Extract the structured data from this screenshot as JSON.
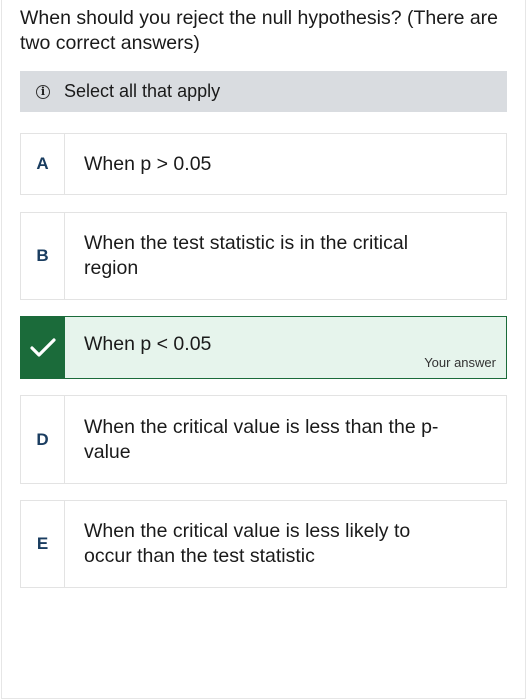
{
  "question": "When should you reject the null hypothesis? (There are two correct answers)",
  "hint": {
    "icon": "info-icon",
    "label": "Select all that apply"
  },
  "options": [
    {
      "letter": "A",
      "text": "When p > 0.05",
      "selected": false
    },
    {
      "letter": "B",
      "text": "When the test statistic is in the critical region",
      "selected": false
    },
    {
      "letter": "",
      "text": "When p < 0.05",
      "selected": true,
      "tag": "Your answer"
    },
    {
      "letter": "D",
      "text": "When the critical value is less than the p-value",
      "selected": false
    },
    {
      "letter": "E",
      "text": "When the critical value is less likely to occur than the test statistic",
      "selected": false
    }
  ],
  "colors": {
    "selected_fill": "#e6f4ec",
    "selected_accent": "#1b6b3a",
    "hint_bg": "#d9dce0"
  }
}
